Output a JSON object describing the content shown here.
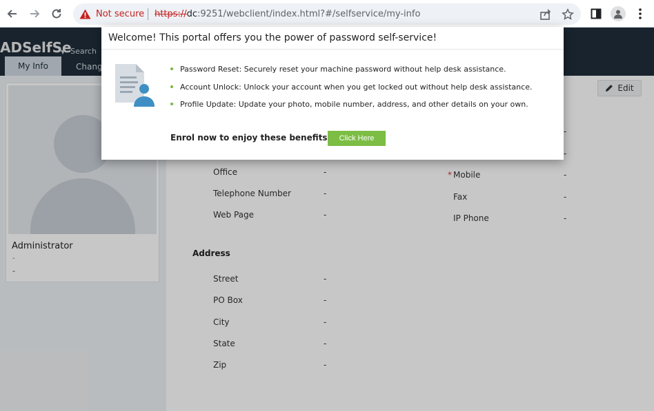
{
  "browser": {
    "not_secure_label": "Not secure",
    "url_protocol": "https://",
    "url_host": "dc",
    "url_rest": ":9251/webclient/index.html?#/selfservice/my-info"
  },
  "app": {
    "logo_text": "ADSelfSe",
    "search_placeholder": "Search",
    "tabs": [
      {
        "label": "My Info"
      },
      {
        "label": "Chang"
      }
    ]
  },
  "profile": {
    "name": "Administrator",
    "sub1": "-",
    "sub2": "-"
  },
  "main": {
    "edit_label": "Edit",
    "left_fields": [
      {
        "label": "Office",
        "value": "-"
      },
      {
        "label": "Telephone Number",
        "value": "-"
      },
      {
        "label": "Web Page",
        "value": "-"
      }
    ],
    "right_fields": [
      {
        "label": "Mobile",
        "value": "-",
        "required": true
      },
      {
        "label": "Fax",
        "value": "-"
      },
      {
        "label": "IP Phone",
        "value": "-"
      }
    ],
    "right_top_values": [
      "-",
      "-"
    ],
    "address_title": "Address",
    "address_fields": [
      {
        "label": "Street",
        "value": "-"
      },
      {
        "label": "PO Box",
        "value": "-"
      },
      {
        "label": "City",
        "value": "-"
      },
      {
        "label": "State",
        "value": "-"
      },
      {
        "label": "Zip",
        "value": "-"
      }
    ]
  },
  "modal": {
    "title": "Welcome! This portal offers you the power of password self-service!",
    "benefits": [
      "Password Reset: Securely reset your machine password without help desk assistance.",
      "Account Unlock: Unlock your account when you get locked out without help desk assistance.",
      "Profile Update: Update your photo, mobile number, address, and other details on your own."
    ],
    "enrol_text": "Enrol now to enjoy these benefits!",
    "button_label": "Click Here"
  },
  "colors": {
    "header_bg": "#1f2e3a",
    "accent_green": "#7cbd44",
    "warning_red": "#c5221f"
  }
}
